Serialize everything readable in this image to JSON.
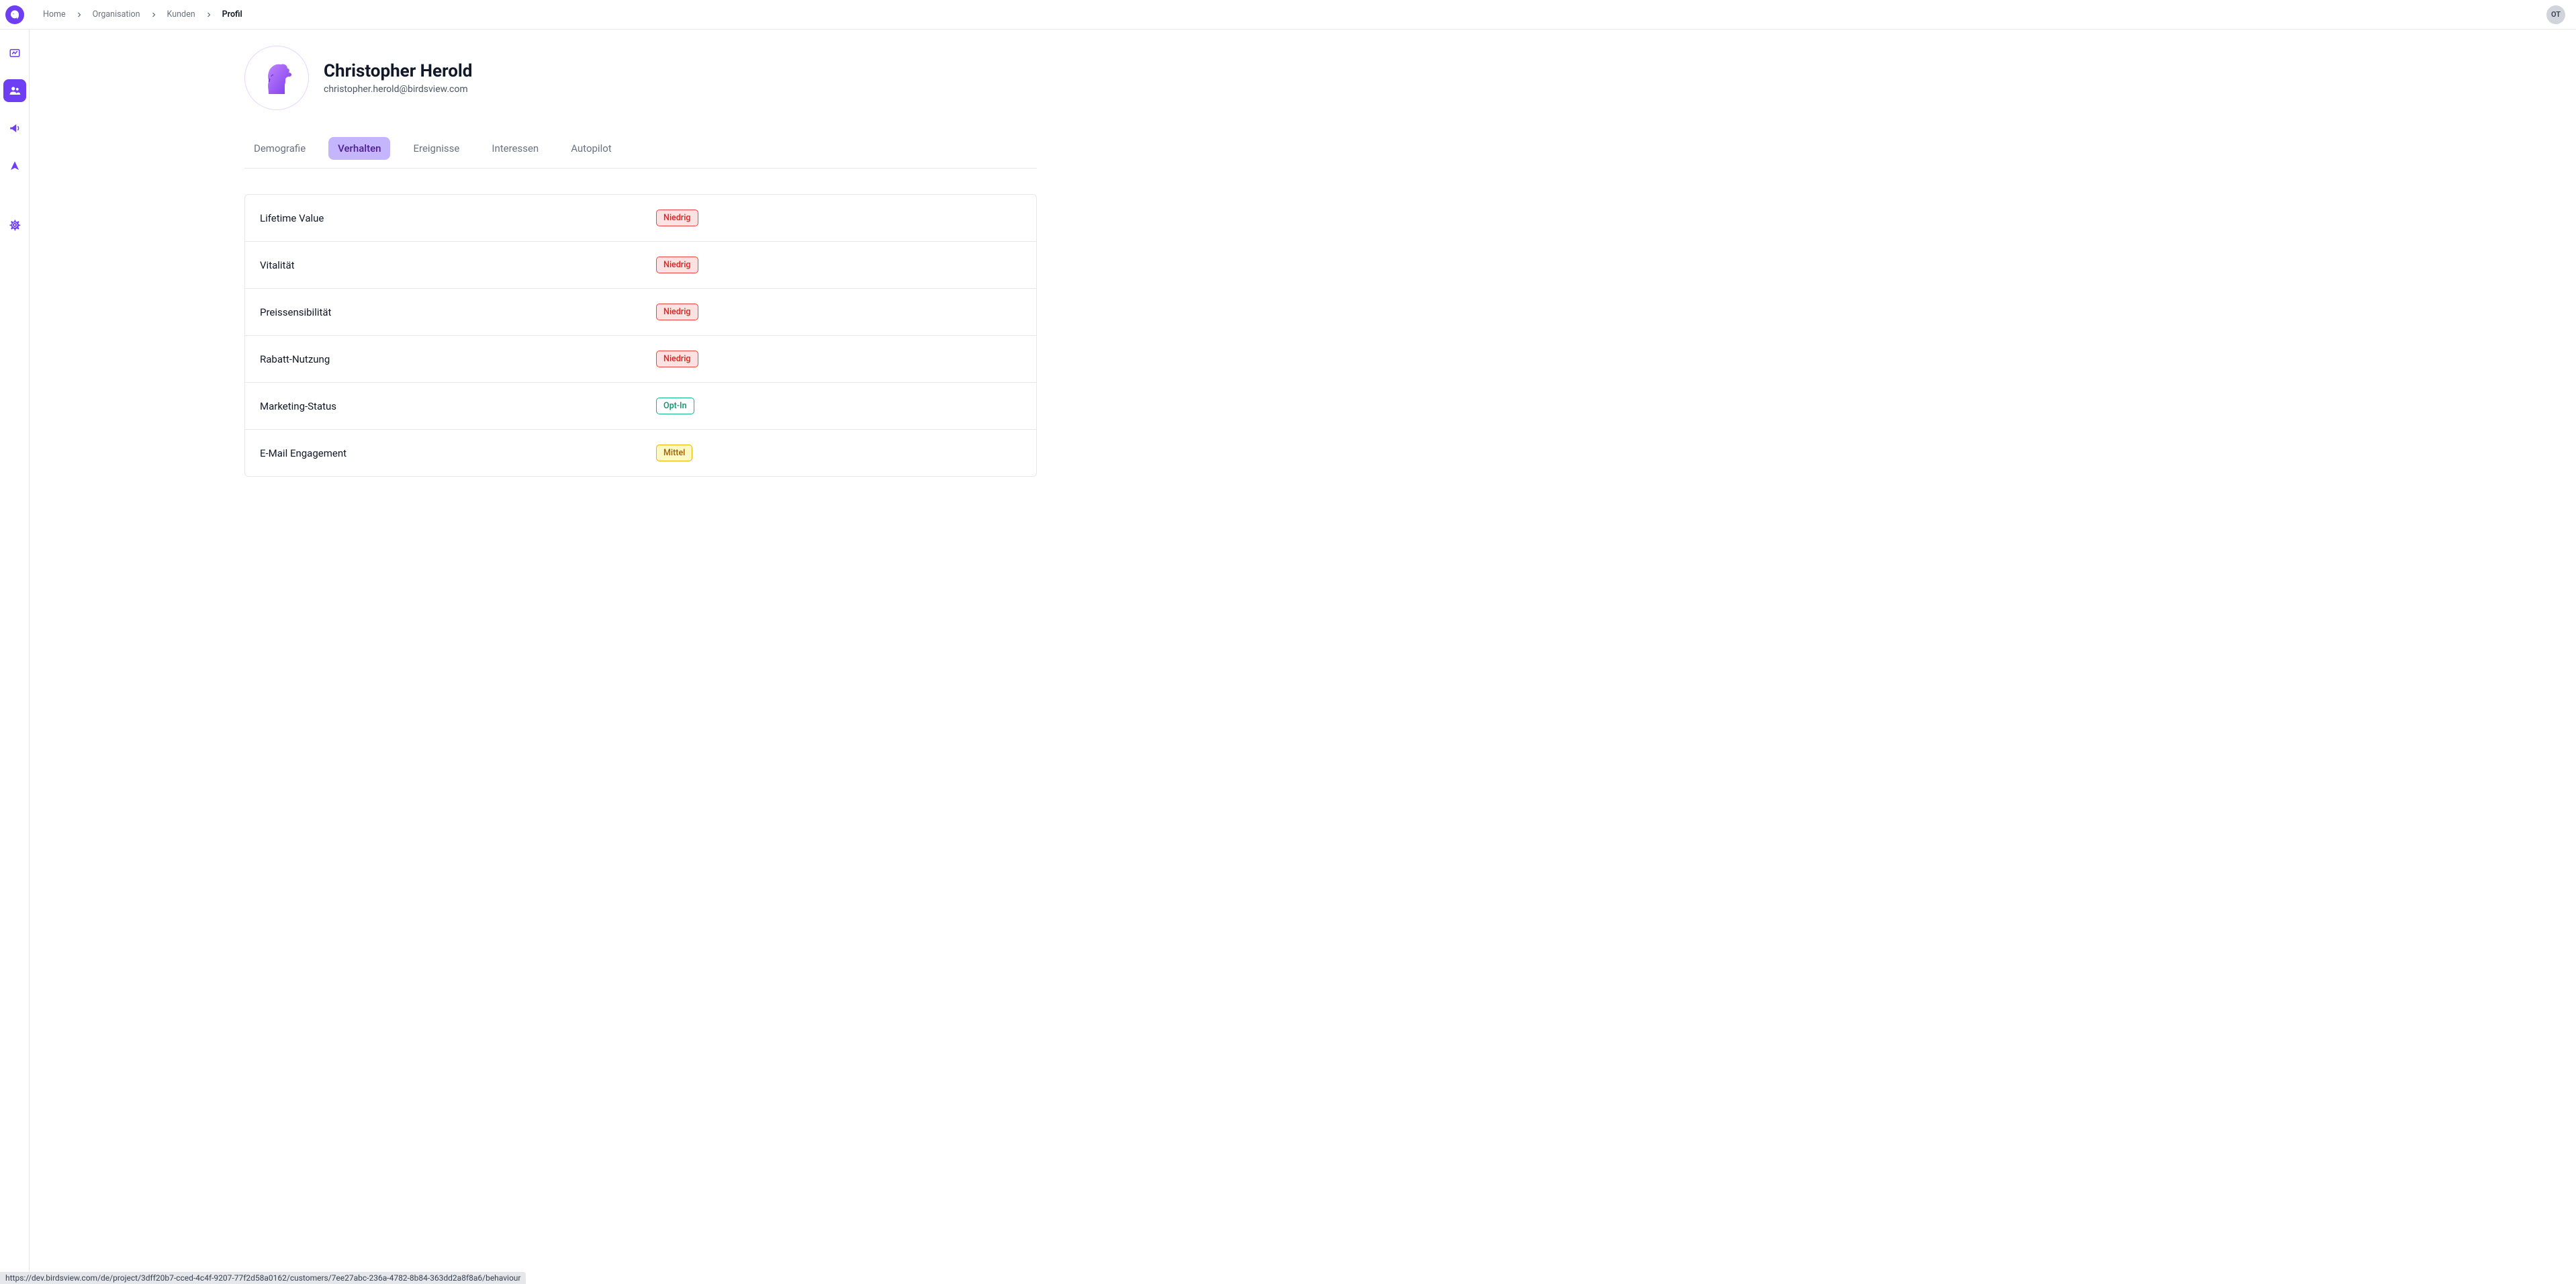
{
  "breadcrumbs": [
    {
      "label": "Home",
      "active": false
    },
    {
      "label": "Organisation",
      "active": false
    },
    {
      "label": "Kunden",
      "active": false
    },
    {
      "label": "Profil",
      "active": true
    }
  ],
  "user": {
    "initials": "OT"
  },
  "profile": {
    "name": "Christopher Herold",
    "email": "christopher.herold@birdsview.com"
  },
  "tabs": [
    {
      "label": "Demografie",
      "active": false
    },
    {
      "label": "Verhalten",
      "active": true
    },
    {
      "label": "Ereignisse",
      "active": false
    },
    {
      "label": "Interessen",
      "active": false
    },
    {
      "label": "Autopilot",
      "active": false
    }
  ],
  "metrics": [
    {
      "label": "Lifetime Value",
      "badge": "Niedrig",
      "badge_type": "low"
    },
    {
      "label": "Vitalität",
      "badge": "Niedrig",
      "badge_type": "low"
    },
    {
      "label": "Preissensibilität",
      "badge": "Niedrig",
      "badge_type": "low"
    },
    {
      "label": "Rabatt-Nutzung",
      "badge": "Niedrig",
      "badge_type": "low"
    },
    {
      "label": "Marketing-Status",
      "badge": "Opt-In",
      "badge_type": "optin"
    },
    {
      "label": "E-Mail Engagement",
      "badge": "Mittel",
      "badge_type": "medium"
    }
  ],
  "status_url": "https://dev.birdsview.com/de/project/3dff20b7-cced-4c4f-9207-77f2d58a0162/customers/7ee27abc-236a-4782-8b84-363dd2a8f8a6/behaviour"
}
